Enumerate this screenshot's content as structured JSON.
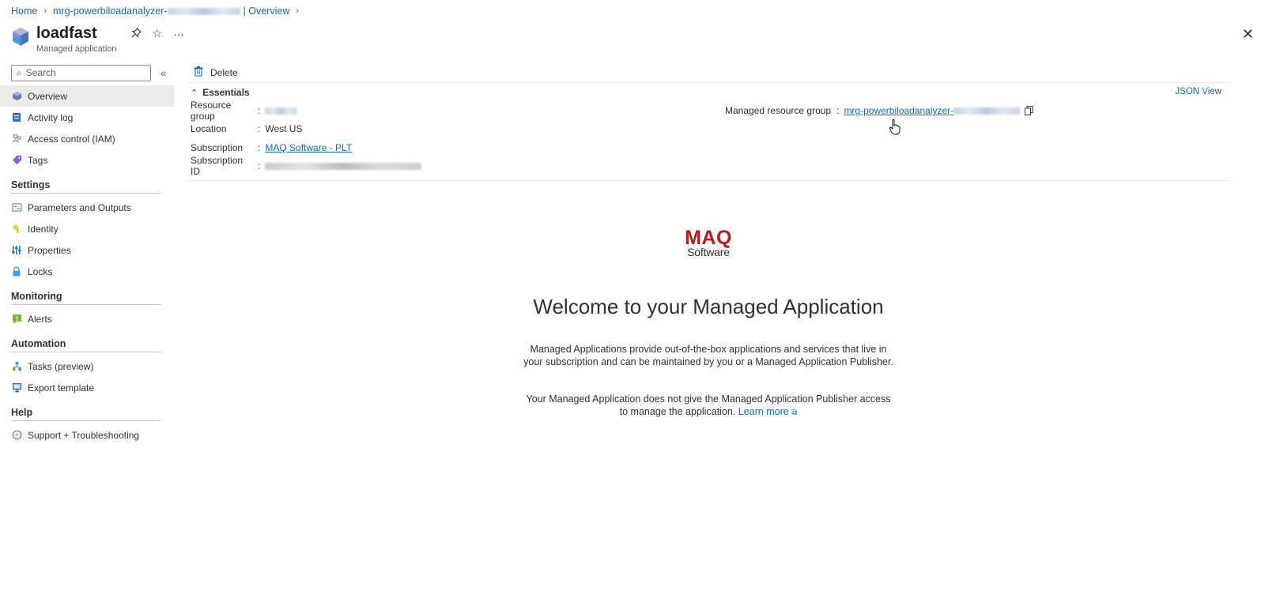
{
  "breadcrumb": {
    "home": "Home",
    "resource_group": "mrg-powerbiloadanalyzer-",
    "page": "| Overview"
  },
  "header": {
    "title": "loadfast",
    "subtitle": "Managed application",
    "more_label": "···"
  },
  "sidebar": {
    "search_placeholder": "Search",
    "items": [
      {
        "label": "Overview",
        "icon": "overview-icon"
      },
      {
        "label": "Activity log",
        "icon": "activity-log-icon"
      },
      {
        "label": "Access control (IAM)",
        "icon": "iam-icon"
      },
      {
        "label": "Tags",
        "icon": "tag-icon"
      }
    ],
    "sections": [
      {
        "title": "Settings",
        "items": [
          {
            "label": "Parameters and Outputs",
            "icon": "parameters-icon"
          },
          {
            "label": "Identity",
            "icon": "identity-icon"
          },
          {
            "label": "Properties",
            "icon": "properties-icon"
          },
          {
            "label": "Locks",
            "icon": "lock-icon"
          }
        ]
      },
      {
        "title": "Monitoring",
        "items": [
          {
            "label": "Alerts",
            "icon": "alert-icon"
          }
        ]
      },
      {
        "title": "Automation",
        "items": [
          {
            "label": "Tasks (preview)",
            "icon": "tasks-icon"
          },
          {
            "label": "Export template",
            "icon": "export-template-icon"
          }
        ]
      },
      {
        "title": "Help",
        "items": [
          {
            "label": "Support + Troubleshooting",
            "icon": "help-icon"
          }
        ]
      }
    ]
  },
  "toolbar": {
    "delete_label": "Delete"
  },
  "essentials": {
    "title": "Essentials",
    "json_view": "JSON View",
    "resource_group_label": "Resource group",
    "location_label": "Location",
    "location_value": "West US",
    "subscription_label": "Subscription",
    "subscription_value": "MAQ Software - PLT",
    "subscription_id_label": "Subscription ID",
    "managed_rg_label": "Managed resource group",
    "managed_rg_value": "mrg-powerbiloadanalyzer-"
  },
  "welcome": {
    "logo_top": "MAQ",
    "logo_bottom": "Software",
    "title": "Welcome to your Managed Application",
    "para1": "Managed Applications provide out-of-the-box applications and services that live in your subscription and can be maintained by you or a Managed Application Publisher.",
    "para2": "Your Managed Application does not give the Managed Application Publisher access to manage the application.",
    "learn_more": "Learn more"
  },
  "colors": {
    "link": "#0f6cbd",
    "active_nav": "#edebe9",
    "logo_red": "#b71c1c"
  }
}
